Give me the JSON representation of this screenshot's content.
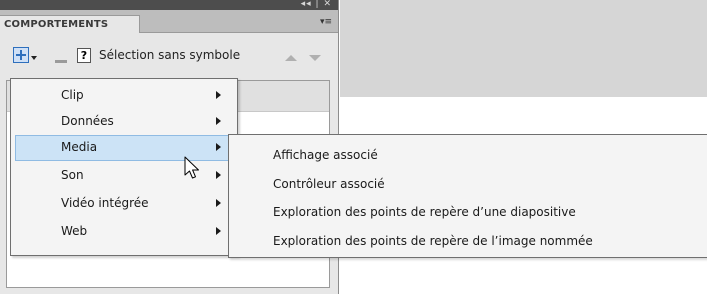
{
  "panel": {
    "tab_label": "COMPORTEMENTS",
    "titlebar_icons": "◂◂ | ✕",
    "panel_menu_icon": "▾≡",
    "toolbar": {
      "add_icon": "add-behavior-icon",
      "remove_icon": "remove-behavior-icon",
      "help_label": "?",
      "selection_label": "Sélection sans symbole",
      "up_icon": "move-up-icon",
      "down_icon": "move-down-icon"
    }
  },
  "menu": {
    "items": [
      {
        "label": "Clip",
        "has_submenu": true,
        "highlighted": false
      },
      {
        "label": "Données",
        "has_submenu": true,
        "highlighted": false
      },
      {
        "label": "Media",
        "has_submenu": true,
        "highlighted": true
      },
      {
        "label": "Son",
        "has_submenu": true,
        "highlighted": false
      },
      {
        "label": "Vidéo intégrée",
        "has_submenu": true,
        "highlighted": false
      },
      {
        "label": "Web",
        "has_submenu": true,
        "highlighted": false
      }
    ]
  },
  "submenu": {
    "items": [
      {
        "label": "Affichage associé"
      },
      {
        "label": "Contrôleur associé"
      },
      {
        "label": "Exploration des points de repère d’une diapositive"
      },
      {
        "label": "Exploration des points de repère de l’image nommée"
      }
    ]
  },
  "colors": {
    "highlight_bg": "#cce3f6",
    "highlight_border": "#8fbbe3",
    "add_icon_blue": "#2e6fbd"
  }
}
